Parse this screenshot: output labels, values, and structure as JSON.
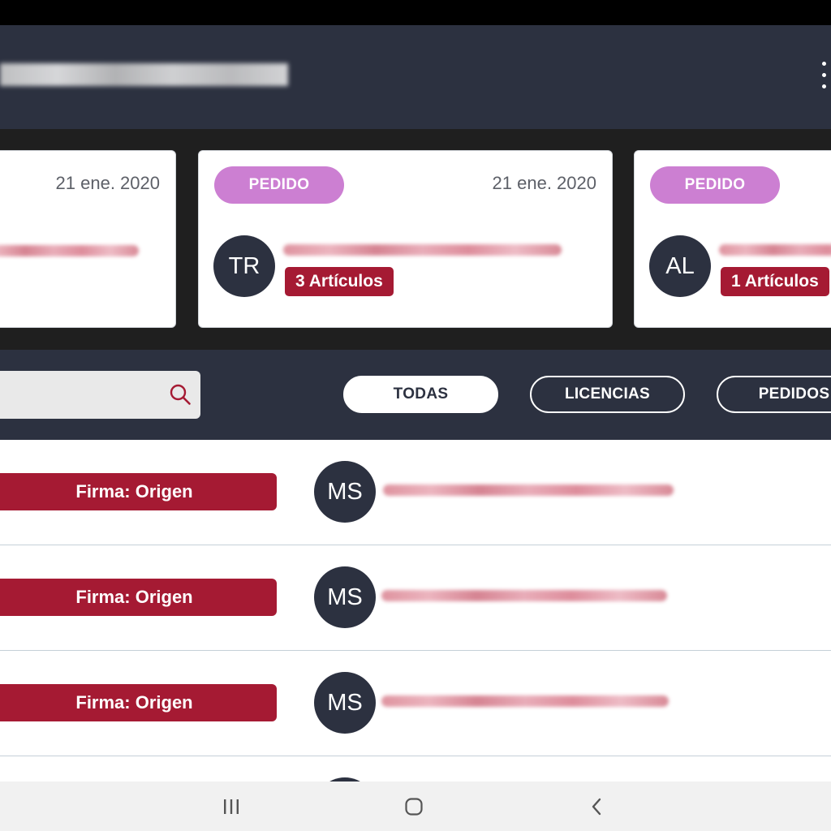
{
  "header": {
    "menu_icon": "more-vertical-icon"
  },
  "cards": [
    {
      "type": "",
      "date": "21 ene. 2020",
      "initials": "",
      "items": ""
    },
    {
      "type": "PEDIDO",
      "date": "21 ene. 2020",
      "initials": "TR",
      "items": "3 Artículos"
    },
    {
      "type": "PEDIDO",
      "date": "",
      "initials": "AL",
      "items": "1 Artículos"
    }
  ],
  "search": {
    "placeholder": "",
    "icon": "search-icon"
  },
  "filters": [
    {
      "label": "TODAS",
      "active": true
    },
    {
      "label": "LICENCIAS",
      "active": false
    },
    {
      "label": "PEDIDOS",
      "active": false
    }
  ],
  "documents": [
    {
      "badge": "Firma: Origen",
      "initials": "MS"
    },
    {
      "badge": "Firma: Origen",
      "initials": "MS"
    },
    {
      "badge": "Firma: Origen",
      "initials": "MS"
    },
    {
      "badge": "",
      "initials": ""
    }
  ],
  "system_nav": {
    "recents_icon": "recents-icon",
    "home_icon": "home-icon",
    "back_icon": "back-icon"
  },
  "colors": {
    "header_bg": "#2c3140",
    "accent_red": "#a51a33",
    "pedido_purple": "#cc7fd2",
    "avatar_bg": "#2c3140"
  }
}
